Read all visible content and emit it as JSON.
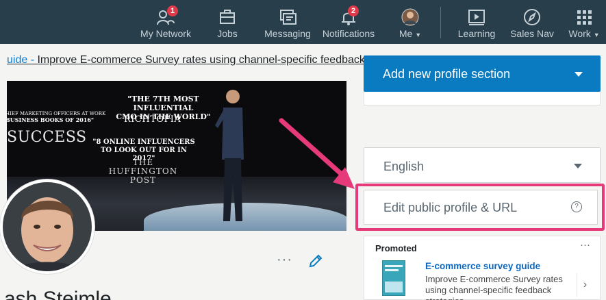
{
  "nav": {
    "items": [
      {
        "label": "My Network",
        "icon": "my-network-icon",
        "badge": "1"
      },
      {
        "label": "Jobs",
        "icon": "jobs-icon"
      },
      {
        "label": "Messaging",
        "icon": "messaging-icon"
      },
      {
        "label": "Notifications",
        "icon": "notifications-icon",
        "badge": "2"
      },
      {
        "label": "Me",
        "icon": "avatar-icon"
      },
      {
        "label": "Learning",
        "icon": "learning-icon"
      },
      {
        "label": "Sales Nav",
        "icon": "sales-nav-icon"
      },
      {
        "label": "Work",
        "icon": "grid-icon"
      }
    ],
    "colors": {
      "bar": "#283e4a",
      "badge": "#e0394a"
    }
  },
  "post": {
    "link_prefix": "uide - ",
    "link_text": "Improve E-commerce Survey rates using channel-specific feedback"
  },
  "hero": {
    "quote1_line1": "\"THE 7TH MOST INFLUENTIAL",
    "quote1_line2": "CMO IN THE WORLD\"",
    "brand": "RICHTOPIA",
    "quote0_line1": "HIEF MARKETING OFFICERS AT WORK",
    "quote0_line2": "BUSINESS BOOKS OF 2016\"",
    "success": "SUCCESS",
    "quote2_line1": "\"8 ONLINE INFLUENCERS",
    "quote2_line2": "TO LOOK OUT FOR IN 2017\"",
    "huff_line1": "THE",
    "huff_line2": "HUFFINGTON",
    "huff_line3": "POST"
  },
  "profile": {
    "name": "ash Steimle",
    "more_label": "···"
  },
  "sidebar": {
    "add_section": "Add new profile section",
    "language": "English",
    "edit_url": "Edit public profile & URL",
    "help": "?",
    "accent": "#0a7bc0",
    "highlight_color": "#e63a7a"
  },
  "promo": {
    "tag": "Promoted",
    "more": "···",
    "title": "E-commerce survey guide",
    "desc": "Improve E-commerce Survey rates using channel-specific feedback strategies",
    "next": "›"
  }
}
